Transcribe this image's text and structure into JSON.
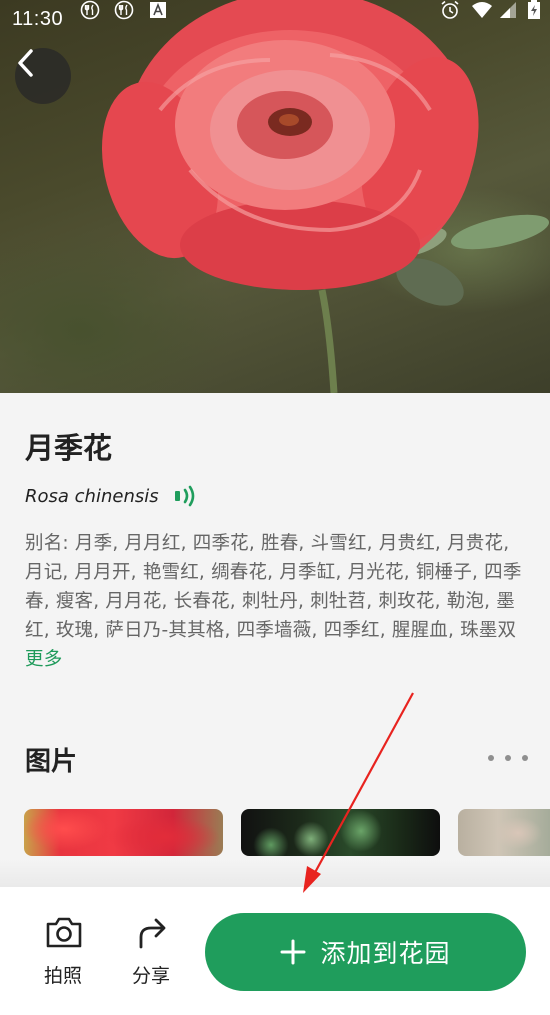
{
  "status_bar": {
    "time": "11:30"
  },
  "header": {
    "back_icon": "chevron-left-icon"
  },
  "plant": {
    "common_name": "月季花",
    "latin_name": "Rosa chinensis",
    "alias_prefix": "别名: ",
    "aliases": "月季, 月月红, 四季花, 胜春, 斗雪红, 月贵红, 月贵花, 月记, 月月开, 艳雪红, 绸春花, 月季缸, 月光花, 铜棰子, 四季春, 瘦客, 月月花, 长春花, 刺牡丹, 刺牡苕, 刺玫花, 勒泡, 墨红, 玫瑰, 萨日乃-其其格, 四季墙薇, 四季红, 腥腥血, 珠墨双",
    "more_label": "更多"
  },
  "images_section": {
    "title": "图片"
  },
  "bottom_bar": {
    "camera_label": "拍照",
    "share_label": "分享",
    "add_label": "添加到花园"
  },
  "colors": {
    "accent": "#1f9d5c",
    "annotation_arrow": "#e8231f"
  }
}
